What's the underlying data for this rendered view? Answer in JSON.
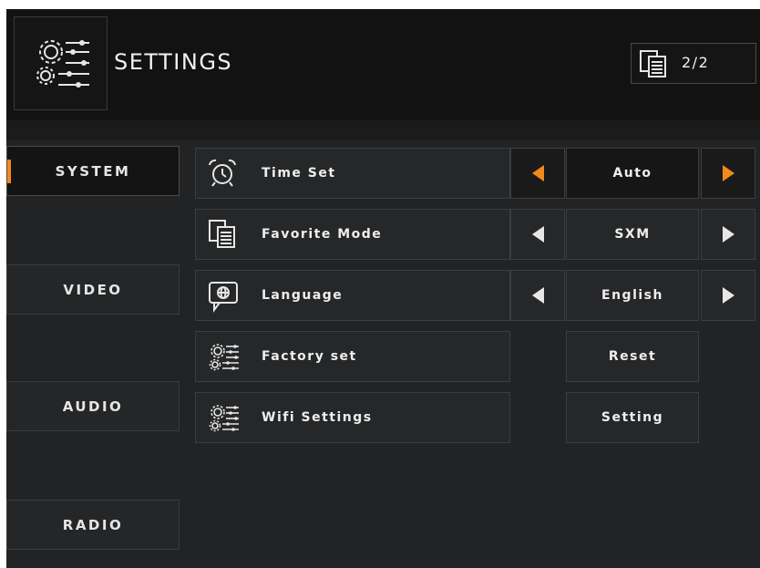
{
  "header": {
    "title": "SETTINGS",
    "page_indicator": "2/2",
    "settings_icon": "settings-gear-sliders-icon",
    "pages_icon": "pages-icon"
  },
  "sidebar": {
    "items": [
      {
        "label": "SYSTEM",
        "active": true
      },
      {
        "label": "VIDEO",
        "active": false
      },
      {
        "label": "AUDIO",
        "active": false
      },
      {
        "label": "RADIO",
        "active": false
      }
    ]
  },
  "settings": [
    {
      "label": "Time Set",
      "value": "Auto",
      "icon": "alarm-clock-icon",
      "has_arrows": true
    },
    {
      "label": "Favorite Mode",
      "value": "SXM",
      "icon": "favorite-pages-icon",
      "has_arrows": true
    },
    {
      "label": "Language",
      "value": "English",
      "icon": "globe-chat-icon",
      "has_arrows": true
    },
    {
      "label": "Factory set",
      "value": "Reset",
      "icon": "gear-sliders-icon",
      "has_arrows": false
    },
    {
      "label": "Wifi Settings",
      "value": "Setting",
      "icon": "gear-sliders-icon",
      "has_arrows": false
    }
  ],
  "colors": {
    "accent": "#f28a1a",
    "background": "#222324",
    "header_bg": "#121212"
  }
}
